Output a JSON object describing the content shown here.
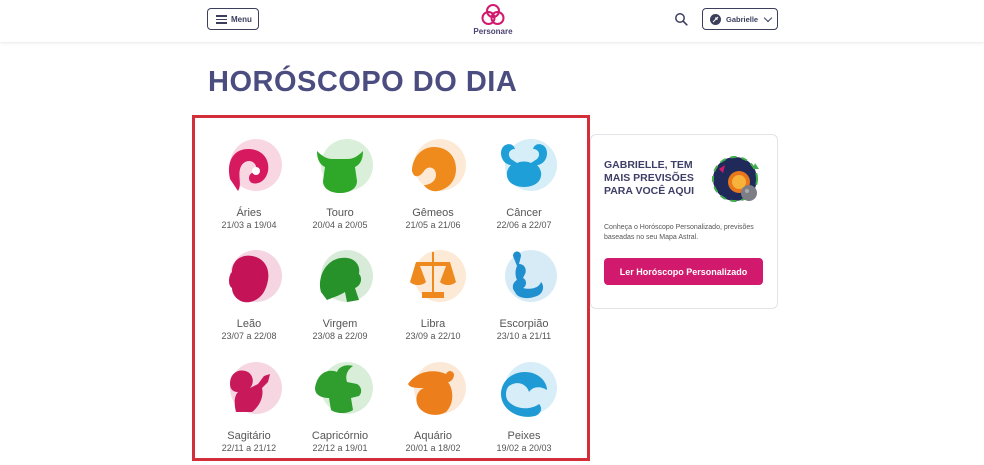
{
  "header": {
    "menu_label": "Menu",
    "logo_text": "Personare",
    "user_name": "Gabrielle"
  },
  "page": {
    "title": "HORÓSCOPO DO DIA"
  },
  "signs": [
    {
      "name": "Áries",
      "dates": "21/03 a 19/04",
      "color": "#d7195f",
      "icon": "aries-icon"
    },
    {
      "name": "Touro",
      "dates": "20/04 a 20/05",
      "color": "#2fa82a",
      "icon": "taurus-icon"
    },
    {
      "name": "Gêmeos",
      "dates": "21/05 a 21/06",
      "color": "#ef8a1d",
      "icon": "gemini-icon"
    },
    {
      "name": "Câncer",
      "dates": "22/06 a 22/07",
      "color": "#1e9fd8",
      "icon": "cancer-icon"
    },
    {
      "name": "Leão",
      "dates": "23/07 a 22/08",
      "color": "#c41457",
      "icon": "leo-icon"
    },
    {
      "name": "Virgem",
      "dates": "23/08 a 22/09",
      "color": "#27912a",
      "icon": "virgo-icon"
    },
    {
      "name": "Libra",
      "dates": "23/09 a 22/10",
      "color": "#ee8a1d",
      "icon": "libra-icon"
    },
    {
      "name": "Escorpião",
      "dates": "23/10 a 21/11",
      "color": "#1f8fcf",
      "icon": "scorpio-icon"
    },
    {
      "name": "Sagitário",
      "dates": "22/11 a 21/12",
      "color": "#c8195a",
      "icon": "sagittarius-icon"
    },
    {
      "name": "Capricórnio",
      "dates": "22/12 a 19/01",
      "color": "#2f9e2e",
      "icon": "capricorn-icon"
    },
    {
      "name": "Aquário",
      "dates": "20/01 a 18/02",
      "color": "#ec7e1c",
      "icon": "aquarius-icon"
    },
    {
      "name": "Peixes",
      "dates": "19/02 a 20/03",
      "color": "#1f9ad4",
      "icon": "pisces-icon"
    }
  ],
  "card": {
    "title": "GABRIELLE, TEM MAIS PREVISÕES PARA VOCÊ AQUI",
    "description": "Conheça o Horóscopo Personalizado, previsões baseadas no seu Mapa Astral.",
    "button_label": "Ler Horóscopo Personalizado"
  },
  "colors": {
    "brand": "#d11a6e",
    "title": "#4b4d80",
    "highlight_border": "#d32f3a"
  }
}
